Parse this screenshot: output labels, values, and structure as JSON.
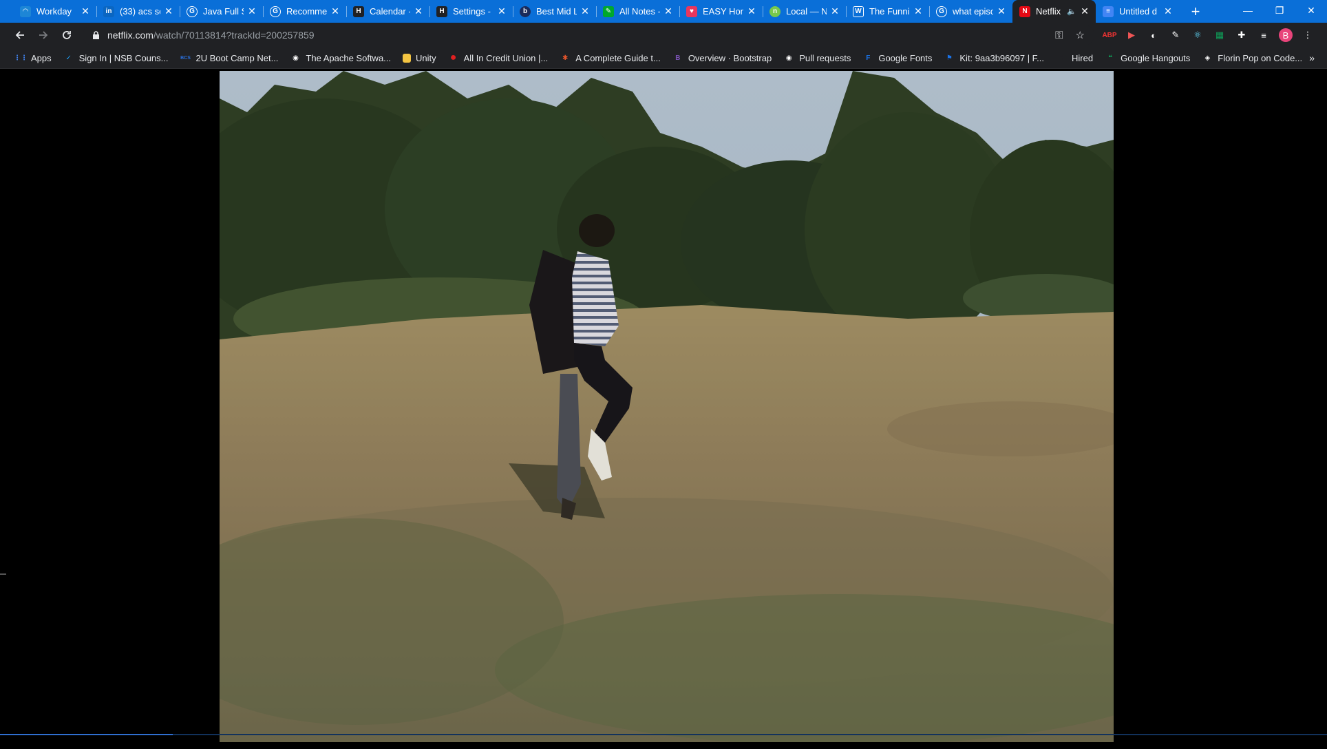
{
  "browser": {
    "tabs": [
      {
        "title": "Workday",
        "icon": "workday-icon",
        "color": "#1d86d6",
        "glyph": "◠",
        "active": false
      },
      {
        "title": "(33) acs sc",
        "icon": "linkedin-icon",
        "color": "#0a66c2",
        "glyph": "in",
        "active": false
      },
      {
        "title": "Java Full St",
        "icon": "google-icon",
        "color": "#ffffff",
        "glyph": "G",
        "active": false
      },
      {
        "title": "Recommen",
        "icon": "google-icon",
        "color": "#ffffff",
        "glyph": "G",
        "active": false
      },
      {
        "title": "Calendar -",
        "icon": "h-icon",
        "color": "#202124",
        "glyph": "H",
        "active": false
      },
      {
        "title": "Settings - ",
        "icon": "h-icon",
        "color": "#202124",
        "glyph": "H",
        "active": false
      },
      {
        "title": "Best Mid L",
        "icon": "b-circle-icon",
        "color": "#1a2b5c",
        "glyph": "b",
        "active": false
      },
      {
        "title": "All Notes -",
        "icon": "evernote-icon",
        "color": "#00a82d",
        "glyph": "✎",
        "active": false
      },
      {
        "title": "EASY Hom",
        "icon": "heart-icon",
        "color": "#e8365d",
        "glyph": "♥",
        "active": false
      },
      {
        "title": "Local — N",
        "icon": "n-circle-icon",
        "color": "#77c84b",
        "glyph": "n",
        "active": false
      },
      {
        "title": "The Funni",
        "icon": "wikipedia-icon",
        "color": "#ffffff",
        "glyph": "W",
        "active": false
      },
      {
        "title": "what episo",
        "icon": "google-icon",
        "color": "#ffffff",
        "glyph": "G",
        "active": false
      },
      {
        "title": "Netflix",
        "icon": "netflix-icon",
        "color": "#e50914",
        "glyph": "N",
        "active": true
      },
      {
        "title": "Untitled d",
        "icon": "docs-icon",
        "color": "#4285f4",
        "glyph": "≡",
        "active": false
      }
    ],
    "new_tab": "+",
    "window": {
      "minimize": "—",
      "restore": "❐",
      "close": "✕"
    },
    "url_host": "netflix.com",
    "url_path": "/watch/70113814?trackId=200257859",
    "profile_initial": "B",
    "bookmarks": [
      {
        "label": "Apps",
        "icon": "apps-grid-icon",
        "color": "#4285f4",
        "glyph": "⋮⋮"
      },
      {
        "label": "Sign In | NSB Couns...",
        "icon": "bird-icon",
        "color": "#1d9bf0",
        "glyph": "✓"
      },
      {
        "label": "2U Boot Camp Net...",
        "icon": "bcs-icon",
        "color": "#2a6fdb",
        "glyph": "BCS"
      },
      {
        "label": "The Apache Softwa...",
        "icon": "github-icon",
        "color": "#ffffff",
        "glyph": "◉"
      },
      {
        "label": "Unity",
        "icon": "folder-icon",
        "color": "#f4c542",
        "glyph": "▮"
      },
      {
        "label": "All In Credit Union |...",
        "icon": "red-circle-icon",
        "color": "#e02020",
        "glyph": "●"
      },
      {
        "label": "A Complete Guide t...",
        "icon": "css-tricks-icon",
        "color": "#e8552b",
        "glyph": "✱"
      },
      {
        "label": "Overview · Bootstrap",
        "icon": "bootstrap-icon",
        "color": "#7952b3",
        "glyph": "B"
      },
      {
        "label": "Pull requests",
        "icon": "github-icon",
        "color": "#ffffff",
        "glyph": "◉"
      },
      {
        "label": "Google Fonts",
        "icon": "google-fonts-icon",
        "color": "#1a73e8",
        "glyph": "F"
      },
      {
        "label": "Kit: 9aa3b96097 | F...",
        "icon": "flag-icon",
        "color": "#1a73e8",
        "glyph": "⚑"
      },
      {
        "label": "Hired",
        "icon": "h-icon",
        "color": "#202124",
        "glyph": "H"
      },
      {
        "label": "Google Hangouts",
        "icon": "hangouts-icon",
        "color": "#0f9d58",
        "glyph": "❝"
      },
      {
        "label": "Florin Pop on Code...",
        "icon": "codepen-icon",
        "color": "#ffffff",
        "glyph": "◈"
      }
    ],
    "more_bookmarks": "»"
  },
  "player": {
    "progress": 0.13
  }
}
